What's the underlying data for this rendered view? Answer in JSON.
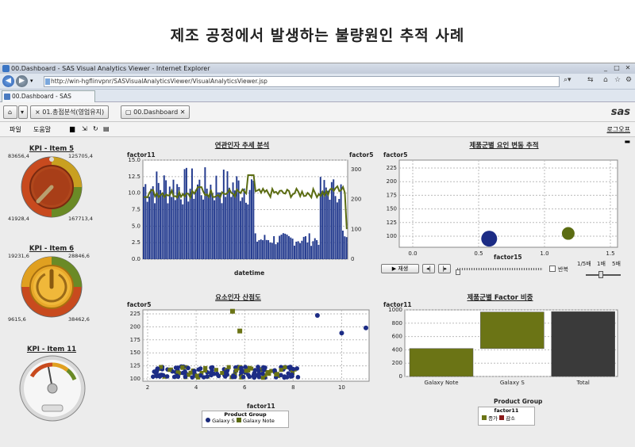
{
  "headline": "제조 공정에서 발생하는 불량원인 추적 사례",
  "window": {
    "title": "00.Dashboard - SAS Visual Analytics Viewer - Internet Explorer",
    "url": "http://win-hgflinvpnr/SASVisualAnalyticsViewer/VisualAnalyticsViewer.jsp",
    "tabs": [
      "00.Dashboard - SAS Vis...",
      "× 01.총점분석(영업유지)",
      "00.Dashboard"
    ],
    "logo": "sas",
    "menu": [
      "파일",
      "도움말"
    ],
    "logout": "로그오프"
  },
  "kpis": [
    {
      "title": "KPI - Item 5",
      "labels": [
        "83656,4",
        "125705,4",
        "41928,4",
        "167713,4"
      ],
      "value_fraction": 0.2
    },
    {
      "title": "KPI - Item 6",
      "labels": [
        "19231,6",
        "28846,6",
        "9615,6",
        "38462,6"
      ],
      "value_fraction": 0.5
    },
    {
      "title": "KPI - Item 11",
      "labels": [],
      "value_fraction": 0.33
    }
  ],
  "charts": {
    "trend": {
      "title": "연관인자 추세 분석",
      "y_left_label": "factor11",
      "y_right_label": "factor5",
      "x_label": "datetime",
      "y_left_ticks": [
        "15.0",
        "12.5",
        "10.0",
        "7.5",
        "5.0",
        "2.5",
        "0.0"
      ],
      "y_right_ticks": [
        "300",
        "200",
        "100",
        "0"
      ]
    },
    "bubble": {
      "title": "제품군별 요인 변동 추적",
      "y_label": "factor5",
      "x_label": "factor15",
      "y_ticks": [
        "225",
        "200",
        "175",
        "150",
        "125",
        "100"
      ],
      "x_ticks": [
        "0.0",
        "0.5",
        "1.0",
        "1.5"
      ],
      "play_label": "▶ 재생",
      "repeat_label": "반복",
      "speeds": [
        "1/5배",
        "1배",
        "5배"
      ]
    },
    "scatter": {
      "title": "요소인자 산점도",
      "y_label": "factor5",
      "x_label": "factor11",
      "y_ticks": [
        "225",
        "200",
        "175",
        "150",
        "125",
        "100"
      ],
      "x_ticks": [
        "2",
        "4",
        "6",
        "8",
        "10"
      ],
      "legend_title": "Product Group",
      "legend": [
        "Galaxy S",
        "Galaxy Note"
      ]
    },
    "waterfall": {
      "title": "제품군별 Factor 비중",
      "y_label": "factor11",
      "x_label": "Product Group",
      "y_ticks": [
        "1000",
        "800",
        "600",
        "400",
        "200",
        "0"
      ],
      "categories": [
        "Galaxy Note",
        "Galaxy S",
        "Total"
      ],
      "legend_title": "factor11",
      "legend": [
        "증가",
        "감소"
      ]
    }
  },
  "chart_data": [
    {
      "type": "bar",
      "title": "연관인자 추세 분석",
      "xlabel": "datetime",
      "ylabel": "factor11",
      "ylim": [
        0,
        15
      ],
      "series": [
        {
          "name": "factor11",
          "type": "bar"
        },
        {
          "name": "factor5",
          "type": "line",
          "axis": "right",
          "ylim": [
            0,
            300
          ]
        }
      ]
    },
    {
      "type": "scatter",
      "title": "제품군별 요인 변동 추적",
      "xlabel": "factor15",
      "ylabel": "factor5",
      "x": [
        0.58,
        1.18
      ],
      "y": [
        117,
        125
      ],
      "xlim": [
        0,
        1.6
      ],
      "ylim": [
        90,
        240
      ]
    },
    {
      "type": "scatter",
      "title": "요소인자 산점도",
      "xlabel": "factor11",
      "ylabel": "factor5",
      "xlim": [
        2,
        11
      ],
      "ylim": [
        95,
        235
      ],
      "series": [
        {
          "name": "Galaxy S",
          "color": "#1a2a7a",
          "outliers": [
            [
              9,
              222
            ],
            [
              10,
              188
            ],
            [
              11,
              198
            ]
          ]
        },
        {
          "name": "Galaxy Note",
          "color": "#5a6a10",
          "outliers": [
            [
              5.5,
              230
            ],
            [
              5.8,
              192
            ]
          ]
        }
      ]
    },
    {
      "type": "bar",
      "title": "제품군별 Factor 비중",
      "xlabel": "Product Group",
      "ylabel": "factor11",
      "categories": [
        "Galaxy Note",
        "Galaxy S",
        "Total"
      ],
      "values": [
        420,
        560,
        980
      ],
      "ylim": [
        0,
        1000
      ]
    }
  ],
  "colors": {
    "bar": "#233a8e",
    "line": "#5b6c12",
    "olive": "#6b7415",
    "dark": "#3a3a3a",
    "navy": "#1c2c85"
  }
}
